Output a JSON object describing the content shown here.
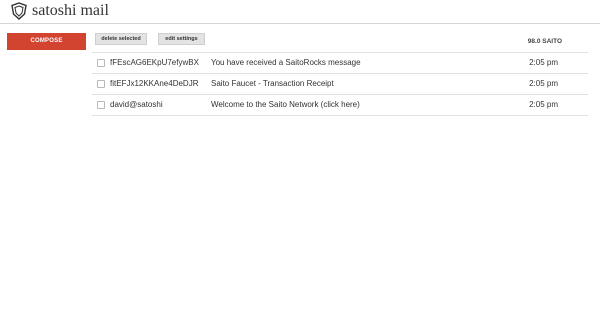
{
  "header": {
    "title": "satoshi mail",
    "logo_icon": "saito-shield-icon"
  },
  "sidebar": {
    "compose_label": "COMPOSE",
    "compose_color": "#d24330"
  },
  "toolbar": {
    "delete_label": "delete selected",
    "edit_label": "edit settings",
    "balance": "98.0 SAITO"
  },
  "messages": [
    {
      "from": "fFEscAG6EKpU7efywBX",
      "subject": "You have received a SaitoRocks message",
      "time": "2:05 pm"
    },
    {
      "from": "fitEFJx12KKAne4DeDJR",
      "subject": "Saito Faucet - Transaction Receipt",
      "time": "2:05 pm"
    },
    {
      "from": "david@satoshi",
      "subject": "Welcome to the Saito Network (click here)",
      "time": "2:05 pm"
    }
  ]
}
